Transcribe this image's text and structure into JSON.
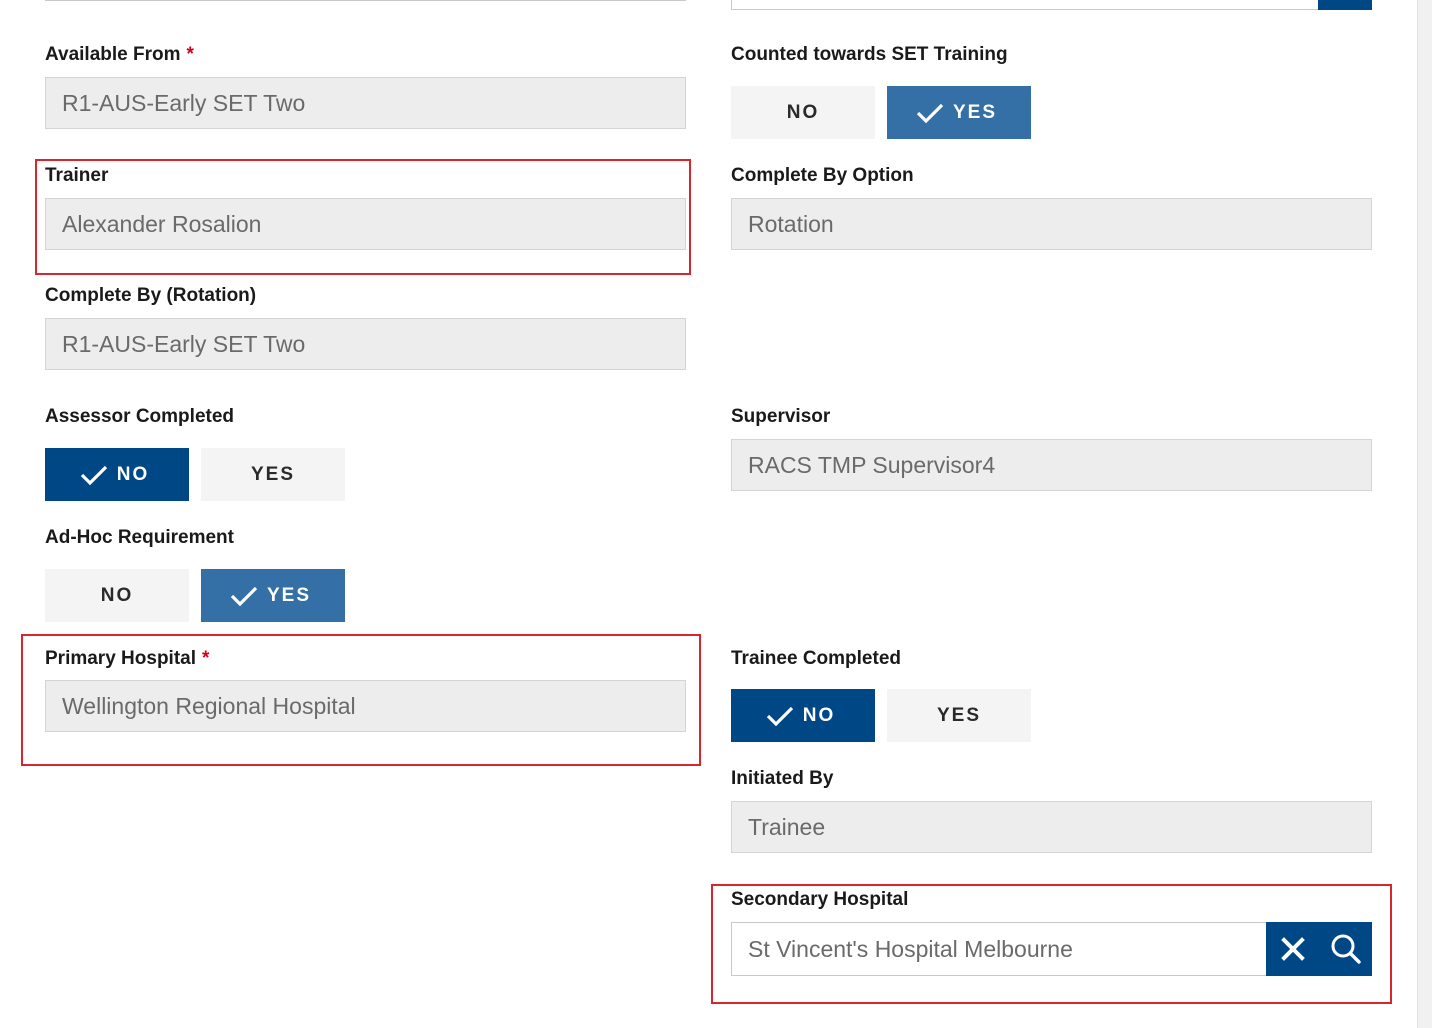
{
  "left": {
    "available_from": {
      "label": "Available From",
      "required": "*",
      "value": "R1-AUS-Early SET Two"
    },
    "trainer": {
      "label": "Trainer",
      "value": "Alexander Rosalion"
    },
    "complete_by_rotation": {
      "label": "Complete By (Rotation)",
      "value": "R1-AUS-Early SET Two"
    },
    "assessor_completed": {
      "label": "Assessor Completed",
      "no": "NO",
      "yes": "YES",
      "selected": "NO"
    },
    "adhoc_requirement": {
      "label": "Ad-Hoc Requirement",
      "no": "NO",
      "yes": "YES",
      "selected": "YES"
    },
    "primary_hospital": {
      "label": "Primary Hospital",
      "required": "*",
      "value": "Wellington Regional Hospital"
    }
  },
  "right": {
    "counted_towards_set": {
      "label": "Counted towards SET Training",
      "no": "NO",
      "yes": "YES",
      "selected": "YES"
    },
    "complete_by_option": {
      "label": "Complete By Option",
      "value": "Rotation"
    },
    "supervisor": {
      "label": "Supervisor",
      "value": "RACS TMP Supervisor4"
    },
    "trainee_completed": {
      "label": "Trainee Completed",
      "no": "NO",
      "yes": "YES",
      "selected": "NO"
    },
    "initiated_by": {
      "label": "Initiated By",
      "value": "Trainee"
    },
    "secondary_hospital": {
      "label": "Secondary Hospital",
      "value": "St Vincent's Hospital Melbourne"
    }
  },
  "icons": {
    "check": "check-icon",
    "clear": "close-icon",
    "search": "search-icon"
  },
  "colors": {
    "primary_dark": "#004785",
    "primary_mid": "#3470a5",
    "toggle_off": "#f4f4f4",
    "readonly_field": "#ededed",
    "highlight": "#d7262f",
    "required": "#d0021b"
  }
}
